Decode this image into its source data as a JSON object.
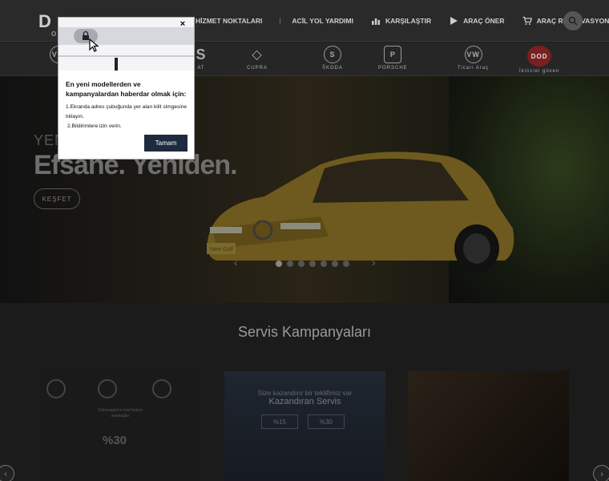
{
  "header": {
    "logo_text": "D",
    "logo_sub": "O",
    "nav": [
      {
        "label": "HİZMET NOKTALARI",
        "icon": "map-pin-icon"
      },
      {
        "label": "ACİL YOL YARDIMI",
        "icon": ""
      },
      {
        "label": "KARŞILAŞTIR",
        "icon": "bar-chart-icon"
      },
      {
        "label": "ARAÇ ÖNER",
        "icon": "play-icon"
      },
      {
        "label": "ARAÇ REZERVASYONU",
        "icon": "cart-icon"
      }
    ],
    "search_icon": "search-icon"
  },
  "brands": [
    {
      "label": "",
      "glyph": "VW",
      "icon": "vw-icon"
    },
    {
      "label": "AT",
      "glyph": "S",
      "icon": "seat-icon"
    },
    {
      "label": "CUPRA",
      "glyph": "◇",
      "icon": "cupra-icon"
    },
    {
      "label": "ŠKODA",
      "glyph": "S",
      "icon": "skoda-icon"
    },
    {
      "label": "PORSCHE",
      "glyph": "P",
      "icon": "porsche-icon"
    },
    {
      "label": "Ticari Araç",
      "glyph": "VW",
      "icon": "vw-commercial-icon"
    },
    {
      "label": "İkinciel güven",
      "glyph": "DOD",
      "icon": "dod-icon"
    }
  ],
  "hero": {
    "pre_title": "YEN",
    "title": "Efsane. Yeniden.",
    "cta": "KEŞFET",
    "plate": "New Golf",
    "dots": 7,
    "active_dot": 0,
    "prev": "‹",
    "next": "›"
  },
  "section": {
    "title": "Servis Kampanyaları",
    "card1": {
      "text": "Volkswagen'e özel bakım avantajları",
      "pct": "%30"
    },
    "card2": {
      "line1": "Size kazandırır bir teklifimiz var",
      "line2": "Kazandıran Servis",
      "box1": "%15",
      "box2": "%30"
    }
  },
  "popup": {
    "close": "×",
    "heading": "En yeni modellerden ve kampanyalardan haberdar olmak için:",
    "step1": "1.Ekranda adres çubuğunda yer alan kilit simgesine tıklayın.",
    "step2": "2.Bildirimlere izin verin.",
    "ok_label": "Tamam"
  },
  "carousel": {
    "left": "‹",
    "right": "›"
  }
}
